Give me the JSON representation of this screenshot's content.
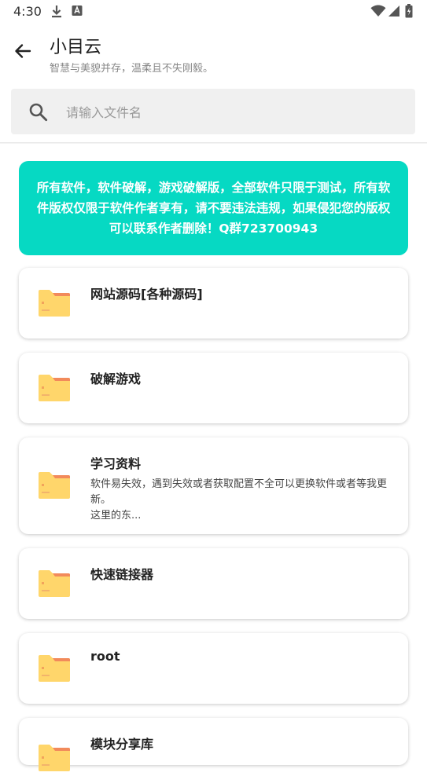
{
  "status": {
    "time": "4:30"
  },
  "header": {
    "title": "小目云",
    "subtitle": "智慧与美貌并存，温柔且不失刚毅。"
  },
  "search": {
    "placeholder": "请输入文件名"
  },
  "notice": {
    "text": "所有软件，软件破解，游戏破解版，全部软件只限于测试，所有软件版权仅限于软件作者享有，请不要违法违规，如果侵犯您的版权可以联系作者删除！Q群723700943"
  },
  "folders": [
    {
      "title": "网站源码[各种源码]",
      "desc": ""
    },
    {
      "title": "破解游戏",
      "desc": ""
    },
    {
      "title": "学习资料",
      "desc_line1": "软件易失效，遇到失效或者获取配置不全可以更换软件或者等我更新。",
      "desc_line2": "这里的东..."
    },
    {
      "title": "快速链接器",
      "desc": ""
    },
    {
      "title": "root",
      "desc": ""
    },
    {
      "title": "模块分享库",
      "desc": ""
    }
  ],
  "colors": {
    "accent": "#06d9c3",
    "folder": "#ffd66b",
    "folder_tab": "#f28a5b"
  }
}
